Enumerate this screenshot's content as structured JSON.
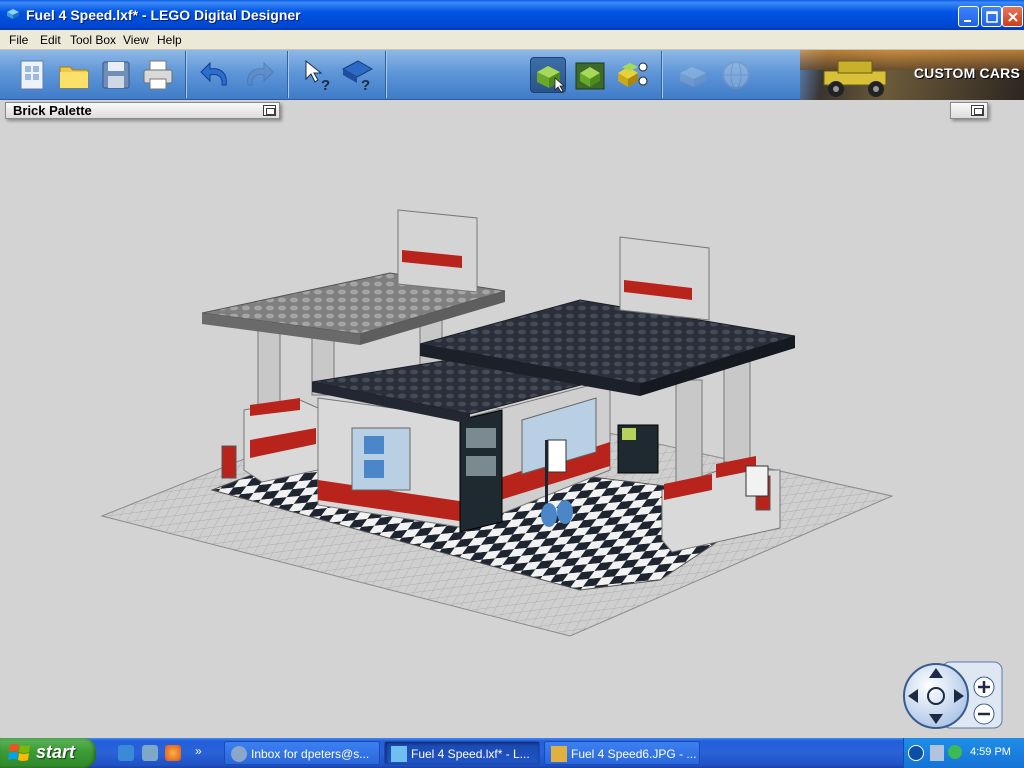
{
  "window": {
    "title": "Fuel 4 Speed.lxf* - LEGO Digital Designer",
    "controls": [
      "minimize",
      "maximize",
      "close"
    ]
  },
  "menu": [
    "File",
    "Edit",
    "Tool Box",
    "View",
    "Help"
  ],
  "toolbar": {
    "groups": [
      [
        "new-file-icon",
        "open-folder-icon",
        "save-disk-icon",
        "print-icon"
      ],
      [
        "undo-icon",
        "redo-icon"
      ],
      [
        "select-help-icon",
        "guide-help-icon"
      ],
      [
        "build-mode-icon",
        "view-mode-icon",
        "building-guide-mode-icon"
      ],
      [
        "online-gallery-icon",
        "globe-icon"
      ]
    ],
    "banner_text": "CUSTOM CARS"
  },
  "palette": {
    "title": "Brick Palette"
  },
  "navigation": [
    "rotate-up",
    "rotate-down",
    "rotate-left",
    "rotate-right",
    "reset-view",
    "zoom-in",
    "zoom-out"
  ],
  "taskbar": {
    "start_label": "start",
    "quick_launch": [
      "ie-icon",
      "messenger-icon",
      "firefox-icon"
    ],
    "tasks": [
      {
        "label": "Inbox for dpeters@s...",
        "active": false
      },
      {
        "label": "Fuel 4 Speed.lxf* - L...",
        "active": true
      },
      {
        "label": "Fuel 4 Speed6.JPG - ...",
        "active": false
      }
    ],
    "clock": "4:59 PM"
  },
  "colors": {
    "titlebar_blue": "#0055e5",
    "toolbar_blue": "#5f97d8",
    "canvas_gray": "#d3d3d3",
    "brick_red": "#b8241c",
    "brick_dark": "#2b2f3a",
    "brick_gray": "#8c8c8c"
  }
}
